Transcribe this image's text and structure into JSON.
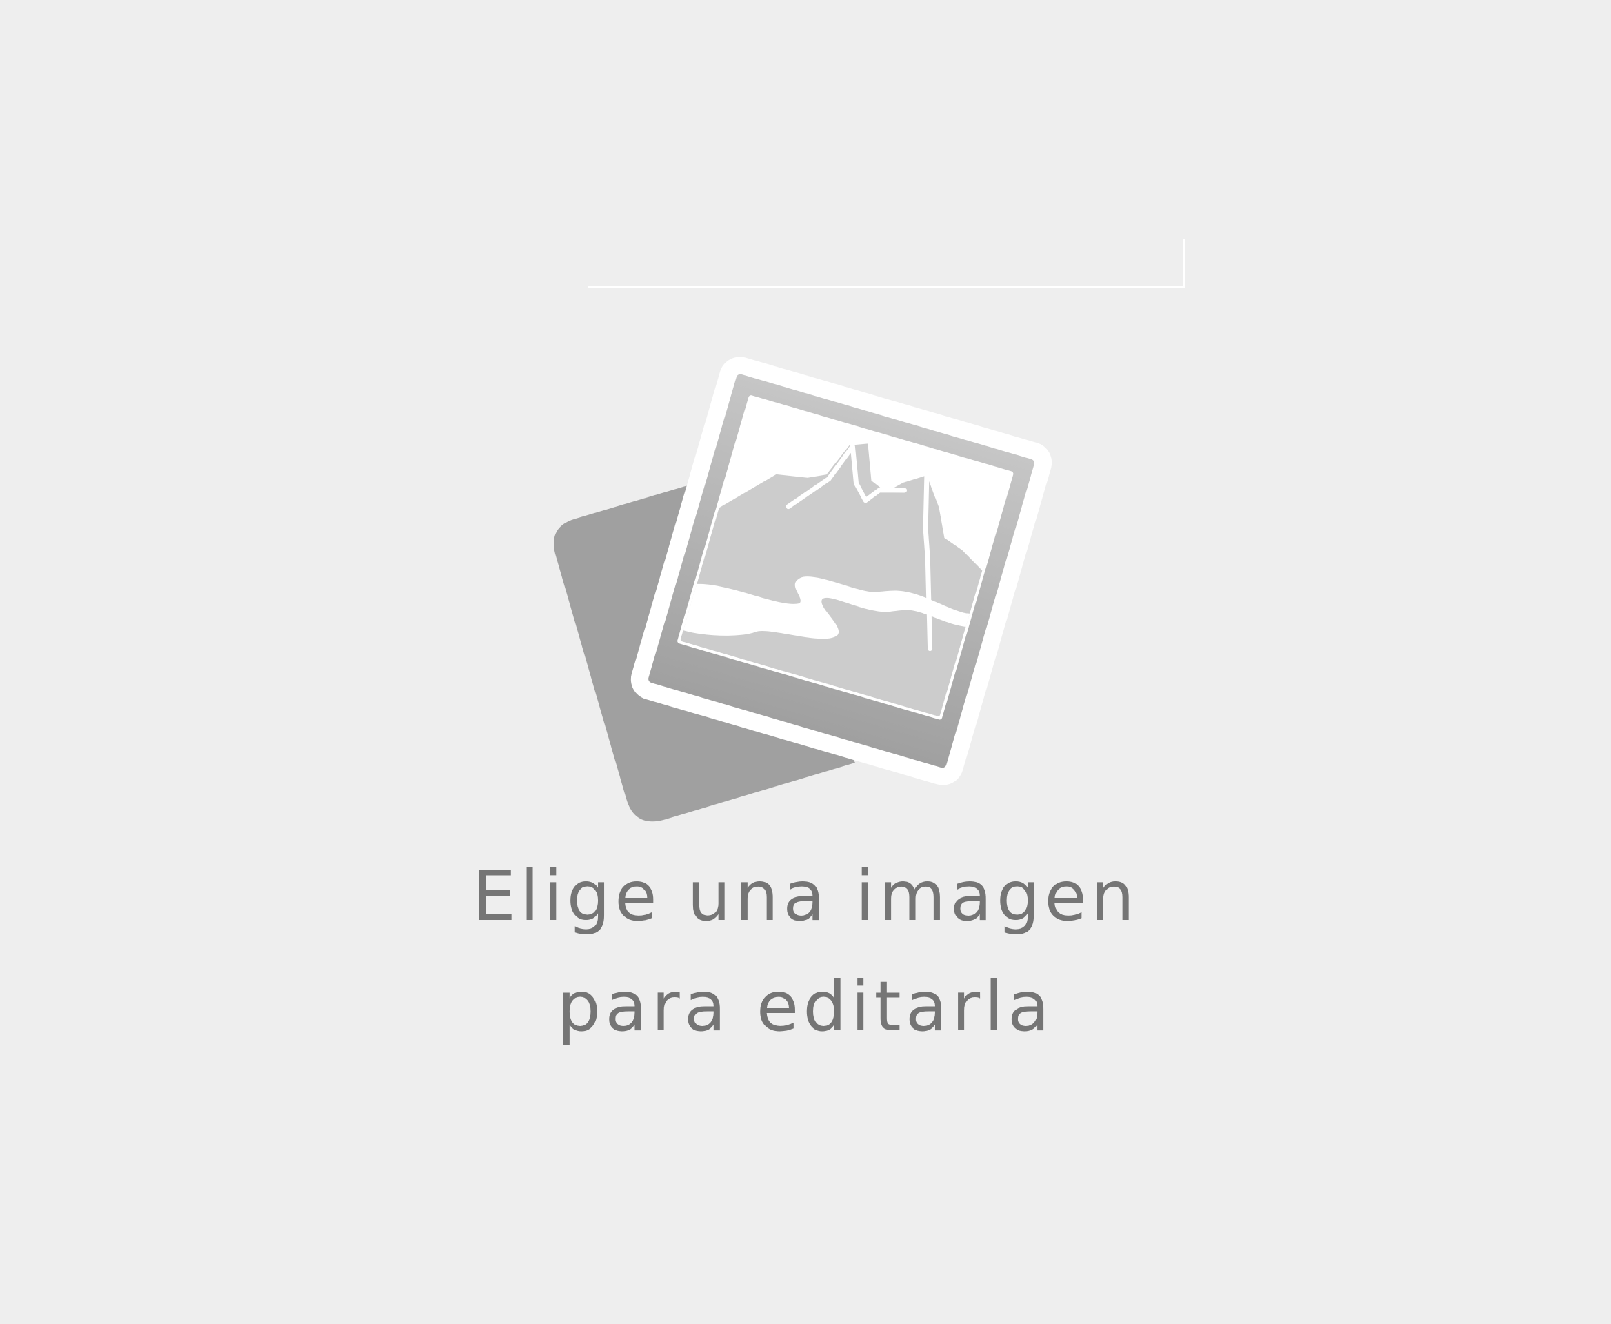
{
  "empty_state": {
    "icon": "photo-placeholder-icon",
    "prompt_line1": "Elige una imagen",
    "prompt_line2": "para editarla"
  },
  "colors": {
    "background": "#eeeeee",
    "icon_back_card": "#a0a0a0",
    "icon_front_card": "#ffffff",
    "icon_sky": "#ffffff",
    "icon_landscape": "#cccccc",
    "text": "#757575"
  }
}
